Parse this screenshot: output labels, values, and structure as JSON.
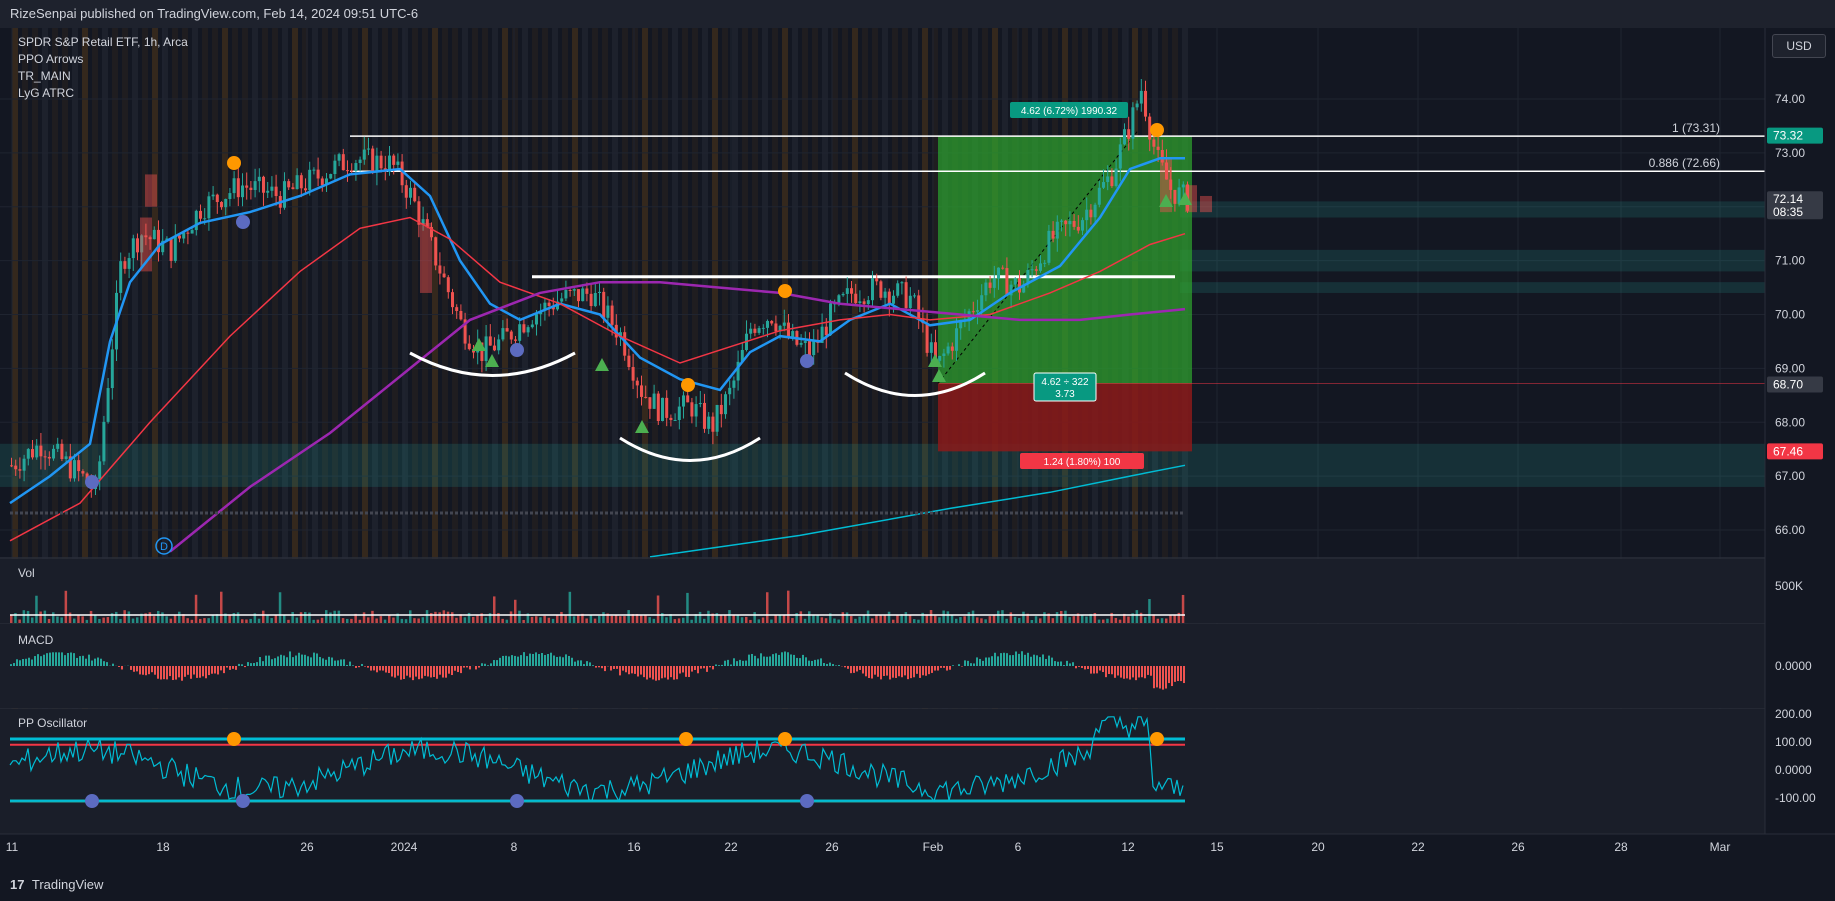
{
  "header": {
    "published": "RizeSenpai published on TradingView.com, Feb 14, 2024 09:51 UTC-6"
  },
  "legend": {
    "items": [
      "SPDR S&P Retail ETF, 1h, Arca",
      "PPO Arrows",
      "TR_MAIN",
      "LyG ATRC"
    ]
  },
  "currency_button": "USD",
  "footer": {
    "brand": "TradingView",
    "logo_glyph": "17"
  },
  "panes": {
    "vol": "Vol",
    "macd": "MACD",
    "ppo": "PP Oscillator"
  },
  "colors": {
    "background": "#131722",
    "grid": "#1f2430",
    "up": "#26a69a",
    "down": "#ef5350",
    "ma_fast": "#2196f3",
    "ma_mid": "#f23645",
    "ma_slow": "#9c27b0",
    "ma_long": "#00bcd4",
    "profit_zone": "#2e9e2e",
    "loss_zone": "#8b1a1a",
    "orange_marker": "#ff9800",
    "blue_marker": "#5c6bc0",
    "green_marker": "#4caf50"
  },
  "chart_data": {
    "type": "candlestick",
    "price_axis": {
      "min": 65.5,
      "max": 75.0,
      "ticks": [
        "74.00",
        "73.00",
        "72.00",
        "71.00",
        "70.00",
        "69.00",
        "68.00",
        "67.00",
        "66.00"
      ]
    },
    "time_axis": {
      "ticks": [
        "11",
        "18",
        "26",
        "2024",
        "8",
        "16",
        "22",
        "26",
        "Feb",
        "6",
        "12",
        "15",
        "20",
        "22",
        "26",
        "28",
        "Mar"
      ]
    },
    "price_labels": [
      {
        "value": "73.32",
        "color": "#089981"
      },
      {
        "value": "72.14",
        "sub": "08:35",
        "color": "#363a45"
      },
      {
        "value": "68.70",
        "color": "#363a45"
      },
      {
        "value": "67.46",
        "color": "#f23645"
      }
    ],
    "fib_lines": [
      {
        "label": "1 (73.31)",
        "value": 73.31
      },
      {
        "label": "0.886 (72.66)",
        "value": 72.66
      }
    ],
    "neckline": {
      "value": 70.7
    },
    "position": {
      "entry": 68.72,
      "target": 73.32,
      "stop": 67.46,
      "profit_label": "4.62 (6.72%) 1990.32",
      "loss_label": "1.24 (1.80%) 100",
      "ratio_label_1": "4.62 ÷ 322",
      "ratio_label_2": "3.73"
    },
    "vol_axis": {
      "ticks": [
        "500K"
      ]
    },
    "macd_axis": {
      "ticks": [
        "0.0000"
      ]
    },
    "ppo_axis": {
      "ticks": [
        "200.00",
        "100.00",
        "0.0000",
        "-100.00"
      ]
    },
    "earnings_marker": "D"
  }
}
